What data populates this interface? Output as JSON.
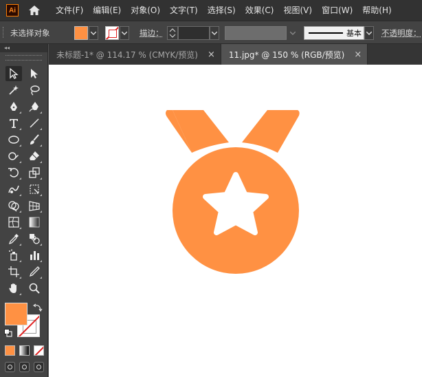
{
  "app": {
    "logo": "Ai"
  },
  "menu": [
    "文件(F)",
    "编辑(E)",
    "对象(O)",
    "文字(T)",
    "选择(S)",
    "效果(C)",
    "视图(V)",
    "窗口(W)",
    "帮助(H)"
  ],
  "control_bar": {
    "selection_status": "未选择对象",
    "stroke_label": "描边：",
    "profile": "基本",
    "opacity_label": "不透明度："
  },
  "tools_panel": {
    "collapse_glyph": "◂◂"
  },
  "tabs": [
    {
      "label": "未标题-1* @ 114.17 % (CMYK/预览)",
      "active": false
    },
    {
      "label": "11.jpg* @ 150 % (RGB/预览)",
      "active": true
    }
  ],
  "tab_close": "×",
  "colors": {
    "fill": "#ff9143",
    "artwork": "#ff9143",
    "stroke_none": "#e02020"
  },
  "artwork": {
    "icon": "medal-star-icon"
  }
}
